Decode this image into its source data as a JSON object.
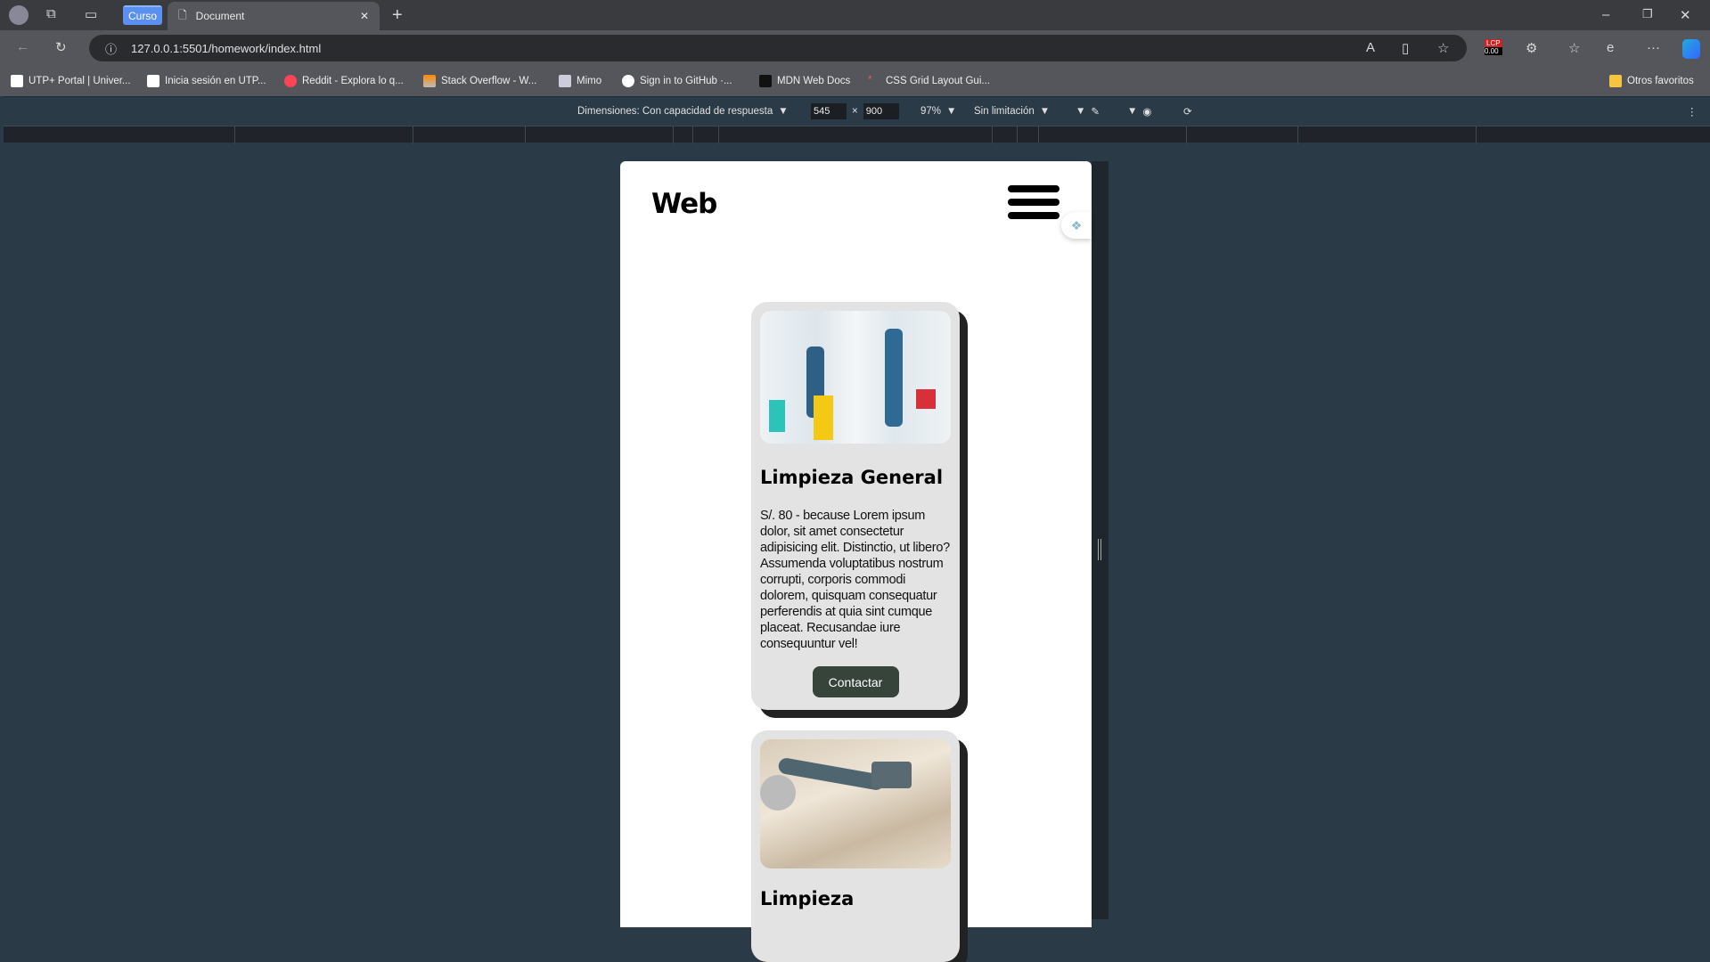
{
  "browser": {
    "tab_group": "Curso",
    "tab_title": "Document",
    "url": "127.0.0.1:5501/homework/index.html",
    "lcp_badge": "LCP",
    "lcp_value": "0.00",
    "bookmarks": [
      {
        "label": "UTP+ Portal | Univer..."
      },
      {
        "label": "Inicia sesión en UTP..."
      },
      {
        "label": "Reddit - Explora lo q..."
      },
      {
        "label": "Stack Overflow - W..."
      },
      {
        "label": "Mimo"
      },
      {
        "label": "Sign in to GitHub ·..."
      },
      {
        "label": "MDN Web Docs"
      },
      {
        "label": "CSS Grid Layout Gui..."
      }
    ],
    "other_favorites": "Otros favoritos"
  },
  "devtools": {
    "dimensions_label": "Dimensiones: Con capacidad de respuesta",
    "width": "545",
    "times": "×",
    "height": "900",
    "zoom": "97%",
    "throttle": "Sin limitación"
  },
  "page": {
    "logo": "Web",
    "cards": [
      {
        "title": "Limpieza General",
        "text": "S/. 80 - because Lorem ipsum dolor, sit amet consectetur adipisicing elit. Distinctio, ut libero? Assumenda voluptatibus nostrum corrupti, corporis commodi dolorem, quisquam consequatur perferendis at quia sint cumque placeat. Recusandae iure consequuntur vel!",
        "button": "Contactar"
      },
      {
        "title": "Limpieza"
      }
    ]
  }
}
